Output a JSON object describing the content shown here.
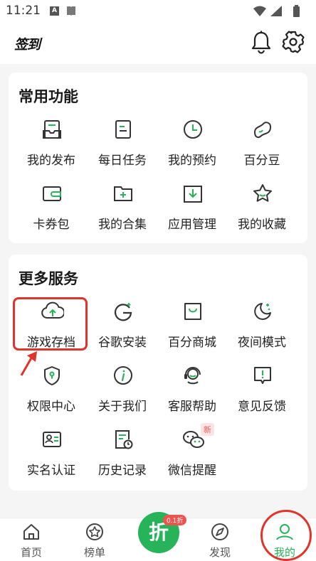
{
  "status_bar": {
    "time": "11:21",
    "a_icon": "A"
  },
  "header": {
    "logo": "签到"
  },
  "common": {
    "title": "常用功能",
    "items": [
      {
        "label": "我的发布",
        "icon": "inbox-icon"
      },
      {
        "label": "每日任务",
        "icon": "task-icon"
      },
      {
        "label": "我的预约",
        "icon": "clock-icon"
      },
      {
        "label": "百分豆",
        "icon": "bean-icon"
      },
      {
        "label": "卡券包",
        "icon": "wallet-icon"
      },
      {
        "label": "我的合集",
        "icon": "folder-add-icon"
      },
      {
        "label": "应用管理",
        "icon": "download-box-icon"
      },
      {
        "label": "我的收藏",
        "icon": "star-icon"
      }
    ]
  },
  "more": {
    "title": "更多服务",
    "items": [
      {
        "label": "游戏存档",
        "icon": "cloud-upload-icon"
      },
      {
        "label": "谷歌安装",
        "icon": "google-icon"
      },
      {
        "label": "百分商城",
        "icon": "shopping-bag-icon"
      },
      {
        "label": "夜间模式",
        "icon": "moon-icon"
      },
      {
        "label": "权限中心",
        "icon": "shield-icon"
      },
      {
        "label": "关于我们",
        "icon": "info-icon"
      },
      {
        "label": "客服帮助",
        "icon": "headset-icon"
      },
      {
        "label": "意见反馈",
        "icon": "feedback-icon"
      },
      {
        "label": "实名认证",
        "icon": "id-card-icon"
      },
      {
        "label": "历史记录",
        "icon": "history-icon"
      },
      {
        "label": "微信提醒",
        "icon": "wechat-icon",
        "badge": "新"
      }
    ]
  },
  "bottom_nav": {
    "home": "首页",
    "rank": "榜单",
    "center": "折",
    "center_badge": "0.1折",
    "discover": "发现",
    "mine": "我的"
  },
  "colors": {
    "accent": "#27b35a",
    "highlight": "#e0332a"
  }
}
